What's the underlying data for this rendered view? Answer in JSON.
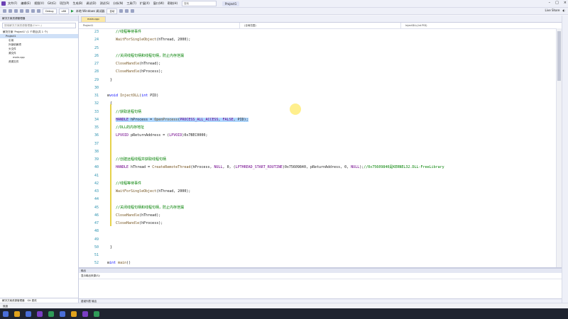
{
  "menu": [
    "文件(F)",
    "编辑(E)",
    "视图(V)",
    "Git(G)",
    "项目(P)",
    "生成(B)",
    "调试(D)",
    "测试(S)",
    "分析(N)",
    "工具(T)",
    "扩展(X)",
    "窗口(W)",
    "帮助(H)"
  ],
  "search_placeholder": "搜索",
  "project_name": "Project1",
  "toolbar": {
    "config": "Debug",
    "platform": "x86",
    "run_label": "本地 Windows 调试器",
    "run_mode": "自动",
    "right_label": "Live Share"
  },
  "sidebar": {
    "title": "解决方案资源管理器",
    "search": "搜索解决方案资源管理器(Ctrl+;)",
    "items": [
      "解决方案 'Project1' (1 个项目/共 1 个)",
      "Project1",
      "引用",
      "外部依赖项",
      "头文件",
      "源文件",
      "main.cpp",
      "资源文件"
    ],
    "tabs": [
      "解决方案资源管理器",
      "Git 更改"
    ]
  },
  "editor": {
    "tab": "main.cpp",
    "nav": [
      "Project1",
      "(全局范围)",
      "InjectDLL(int PID)"
    ]
  },
  "output": {
    "title": "输出",
    "show_from": "显示输出来源(S):",
    "tabs": "错误列表   输出"
  },
  "status": "就绪",
  "clock": {
    "time": "",
    "date": ""
  }
}
